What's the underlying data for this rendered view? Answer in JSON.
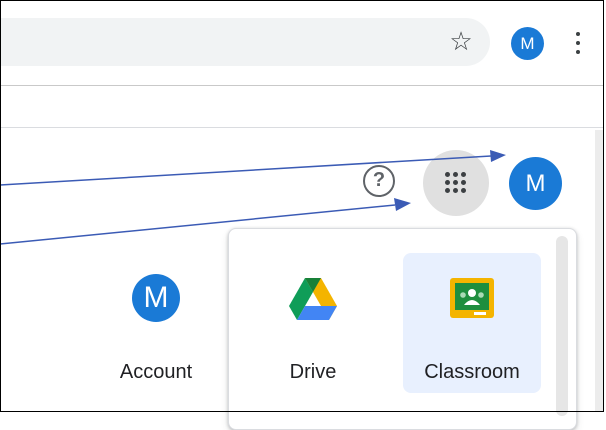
{
  "toolbar": {
    "star_icon": "star-outline-icon",
    "profile_initial": "M",
    "menu_icon": "kebab-menu-icon"
  },
  "header": {
    "help_symbol": "?",
    "apps_icon": "google-apps-grid-icon",
    "account_initial": "M"
  },
  "apps_panel": {
    "items": [
      {
        "label": "Account",
        "icon": "account-avatar-icon",
        "initial": "M",
        "active": false
      },
      {
        "label": "Drive",
        "icon": "drive-icon",
        "active": false
      },
      {
        "label": "Classroom",
        "icon": "classroom-icon",
        "active": true
      }
    ]
  },
  "colors": {
    "accent_blue": "#1a7ad6",
    "active_tile": "#e8f0fe",
    "drive_green": "#0f9d58",
    "drive_yellow": "#f4b400",
    "drive_blue": "#4285f4",
    "classroom_yellow": "#f4b400",
    "classroom_green": "#1e8e3e",
    "annotation_arrow": "#3b5bb5"
  }
}
